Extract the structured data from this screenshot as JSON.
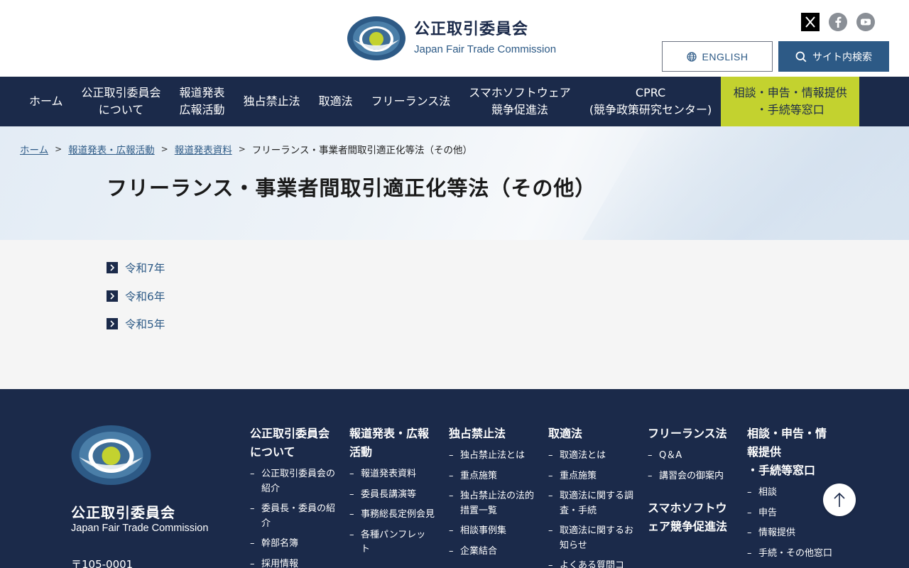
{
  "header": {
    "logo_ja": "公正取引委員会",
    "logo_en": "Japan Fair Trade Commission",
    "english_label": "ENGLISH",
    "search_label": "サイト内検索"
  },
  "nav": {
    "items": [
      "ホーム",
      "公正取引委員会\nについて",
      "報道発表\n広報活動",
      "独占禁止法",
      "取適法",
      "フリーランス法",
      "スマホソフトウェア\n競争促進法",
      "CPRC\n(競争政策研究センター)"
    ],
    "cta": "相談・申告・情報提供\n・手続等窓口"
  },
  "breadcrumb": {
    "items": [
      "ホーム",
      "報道発表・広報活動",
      "報道発表資料"
    ],
    "current": "フリーランス・事業者間取引適正化等法（その他）",
    "separator": ">"
  },
  "page": {
    "title": "フリーランス・事業者間取引適正化等法（その他）",
    "years": [
      "令和7年",
      "令和6年",
      "令和5年"
    ]
  },
  "footer": {
    "name_ja": "公正取引委員会",
    "name_en": "Japan Fair Trade Commission",
    "zip": "〒105-0001",
    "columns": [
      {
        "head": "公正取引委員会\nについて",
        "items": [
          "公正取引委員会の紹介",
          "委員長・委員の紹介",
          "幹部名簿",
          "採用情報"
        ]
      },
      {
        "head": "報道発表・広報\n活動",
        "items": [
          "報道発表資料",
          "委員長講演等",
          "事務総長定例会見",
          "各種パンフレット"
        ]
      },
      {
        "head": "独占禁止法",
        "items": [
          "独占禁止法とは",
          "重点施策",
          "独占禁止法の法的措置一覧",
          "相談事例集",
          "企業結合"
        ]
      },
      {
        "head": "取適法",
        "items": [
          "取適法とは",
          "重点施策",
          "取適法に関する調査・手続",
          "取適法に関するお知らせ",
          "よくある質問コ"
        ]
      },
      {
        "head": "フリーランス法",
        "items": [
          "Q＆A",
          "講習会の御案内"
        ],
        "head2": "スマホソフトウ\nェア競争促進法"
      },
      {
        "head": "相談・申告・情\n報提供\n・手続等窓口",
        "items": [
          "相談",
          "申告",
          "情報提供",
          "手続・その他窓口"
        ]
      }
    ]
  },
  "colors": {
    "navy": "#1b2a4a",
    "accent": "#c3d22f",
    "link": "#2d5a86"
  }
}
